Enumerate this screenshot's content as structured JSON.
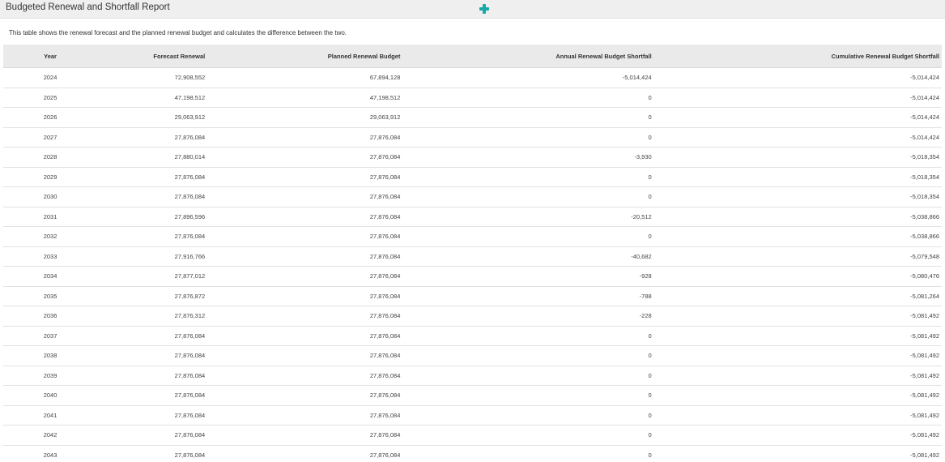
{
  "header": {
    "title": "Budgeted Renewal and Shortfall Report",
    "add_icon": "plus-icon",
    "accent_color": "#17a9a7"
  },
  "description": "This table shows the renewal forecast and the planned renewal budget and calculates the difference between the two.",
  "table": {
    "columns": [
      "Year",
      "Forecast Renewal",
      "Planned Renewal Budget",
      "Annual Renewal Budget Shortfall",
      "Cumulative Renewal Budget Shortfall"
    ],
    "rows": [
      [
        "2024",
        "72,908,552",
        "67,894,128",
        "-5,014,424",
        "-5,014,424"
      ],
      [
        "2025",
        "47,198,512",
        "47,198,512",
        "0",
        "-5,014,424"
      ],
      [
        "2026",
        "29,063,912",
        "29,063,912",
        "0",
        "-5,014,424"
      ],
      [
        "2027",
        "27,876,084",
        "27,876,084",
        "0",
        "-5,014,424"
      ],
      [
        "2028",
        "27,880,014",
        "27,876,084",
        "-3,930",
        "-5,018,354"
      ],
      [
        "2029",
        "27,876,084",
        "27,876,084",
        "0",
        "-5,018,354"
      ],
      [
        "2030",
        "27,876,084",
        "27,876,084",
        "0",
        "-5,018,354"
      ],
      [
        "2031",
        "27,896,596",
        "27,876,084",
        "-20,512",
        "-5,038,866"
      ],
      [
        "2032",
        "27,876,084",
        "27,876,084",
        "0",
        "-5,038,866"
      ],
      [
        "2033",
        "27,916,766",
        "27,876,084",
        "-40,682",
        "-5,079,548"
      ],
      [
        "2034",
        "27,877,012",
        "27,876,084",
        "-928",
        "-5,080,476"
      ],
      [
        "2035",
        "27,876,872",
        "27,876,084",
        "-788",
        "-5,081,264"
      ],
      [
        "2036",
        "27,876,312",
        "27,876,084",
        "-228",
        "-5,081,492"
      ],
      [
        "2037",
        "27,876,084",
        "27,876,084",
        "0",
        "-5,081,492"
      ],
      [
        "2038",
        "27,876,084",
        "27,876,084",
        "0",
        "-5,081,492"
      ],
      [
        "2039",
        "27,876,084",
        "27,876,084",
        "0",
        "-5,081,492"
      ],
      [
        "2040",
        "27,876,084",
        "27,876,084",
        "0",
        "-5,081,492"
      ],
      [
        "2041",
        "27,876,084",
        "27,876,084",
        "0",
        "-5,081,492"
      ],
      [
        "2042",
        "27,876,084",
        "27,876,084",
        "0",
        "-5,081,492"
      ],
      [
        "2043",
        "27,876,084",
        "27,876,084",
        "0",
        "-5,081,492"
      ]
    ]
  }
}
